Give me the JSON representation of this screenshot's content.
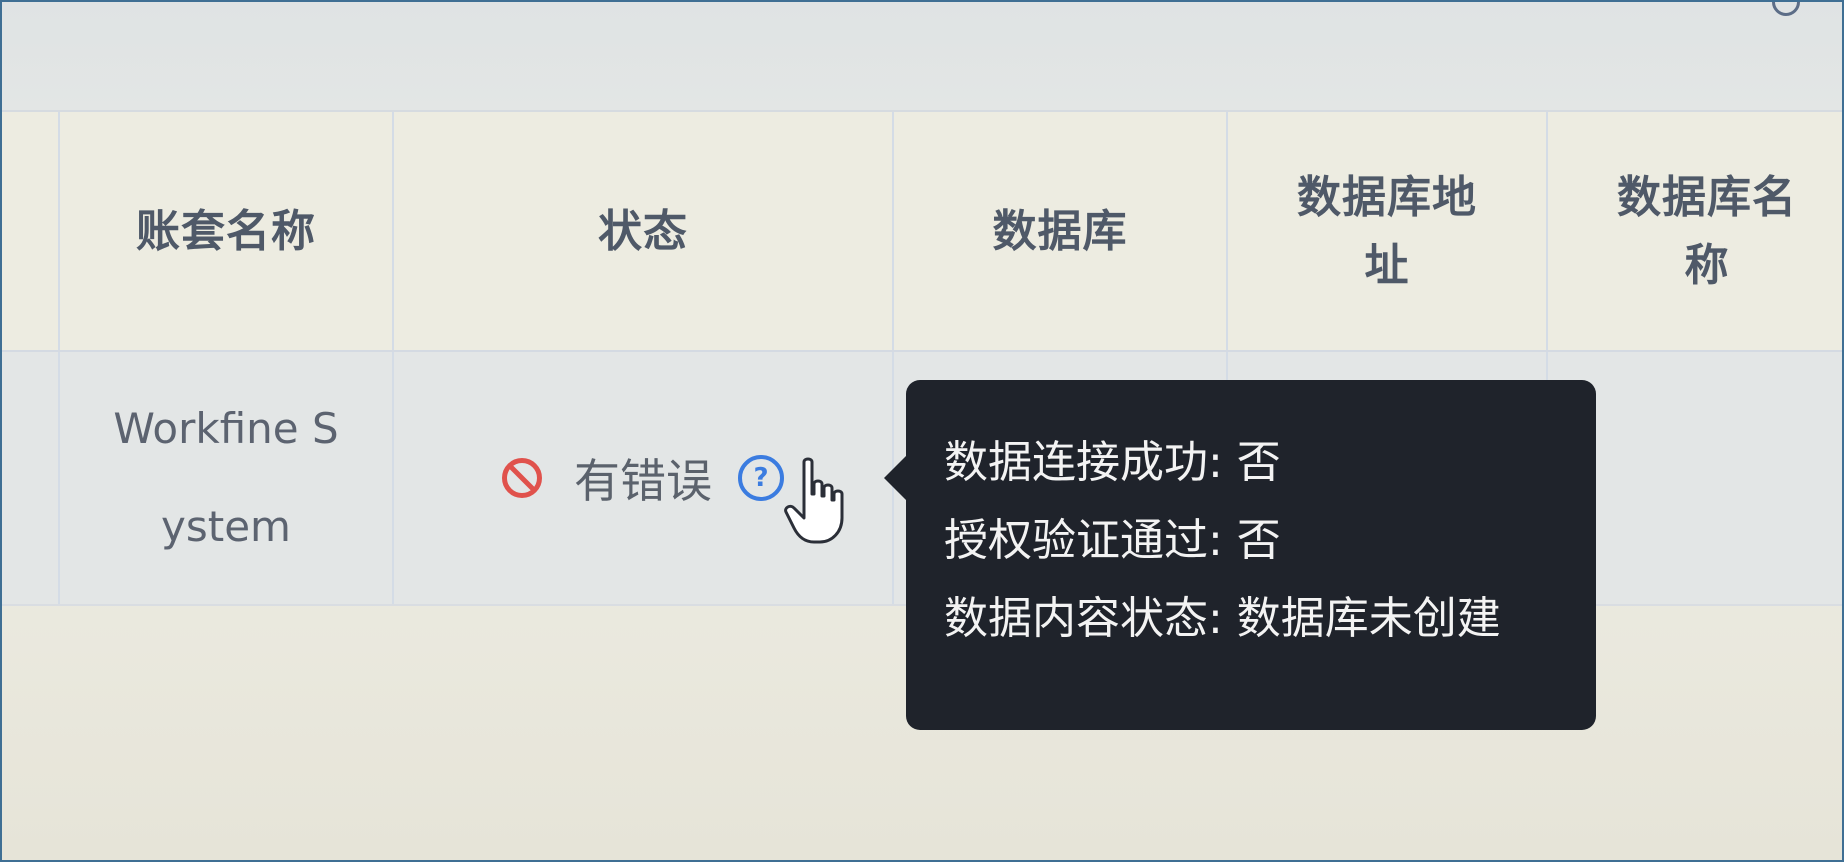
{
  "table": {
    "headers": {
      "name": "账套名称",
      "status": "状态",
      "database": "数据库",
      "db_address": "数据库地址",
      "db_name": "数据库名称"
    },
    "row": {
      "name": "Workfine System",
      "status_label": "有错误",
      "database": "",
      "db_address": "",
      "db_name": ""
    }
  },
  "tooltip": {
    "line1": "数据连接成功: 否",
    "line2": "授权验证通过: 否",
    "line3": "数据内容状态: 数据库未创建"
  },
  "icons": {
    "status_icon": "ban-icon",
    "help_icon": "question-circle-icon",
    "cursor": "hand-pointer-icon"
  },
  "colors": {
    "error_red": "#e0524c",
    "link_blue": "#3b7ce0",
    "tooltip_bg": "#1f232b"
  }
}
